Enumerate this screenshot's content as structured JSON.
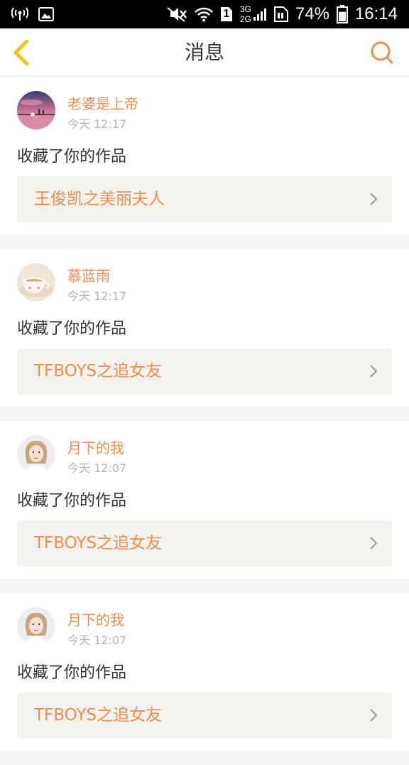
{
  "status_bar": {
    "icons": [
      "hotspot-icon",
      "image-icon",
      "mute-icon",
      "wifi-icon",
      "sim-1-icon",
      "signal-icon",
      "sim-card-icon",
      "battery-icon"
    ],
    "sim_slot": "1",
    "network_top": "3G",
    "network_bottom": "2G",
    "battery": "74%",
    "battery_level": 0.74,
    "time": "16:14"
  },
  "header": {
    "title": "消息",
    "back_icon": "chevron-left-icon",
    "search_icon": "search-icon"
  },
  "colors": {
    "accent": "#f08c4f",
    "back_icon": "#f2c418",
    "text": "#333333",
    "muted": "#b3b3b3",
    "card_link_bg": "#f3f2ec",
    "page_bg": "#f4f4f4"
  },
  "messages": [
    {
      "username": "老婆是上帝",
      "time": "今天 12:17",
      "action": "收藏了你的作品",
      "work": "王俊凯之美丽夫人",
      "avatar": "sunset-avatar"
    },
    {
      "username": "慕蓝雨",
      "time": "今天 12:17",
      "action": "收藏了你的作品",
      "work": "TFBOYS之追女友",
      "avatar": "teacup-avatar"
    },
    {
      "username": "月下的我",
      "time": "今天 12:07",
      "action": "收藏了你的作品",
      "work": "TFBOYS之追女友",
      "avatar": "girl-avatar"
    },
    {
      "username": "月下的我",
      "time": "今天 12:07",
      "action": "收藏了你的作品",
      "work": "TFBOYS之追女友",
      "avatar": "girl-avatar"
    }
  ]
}
